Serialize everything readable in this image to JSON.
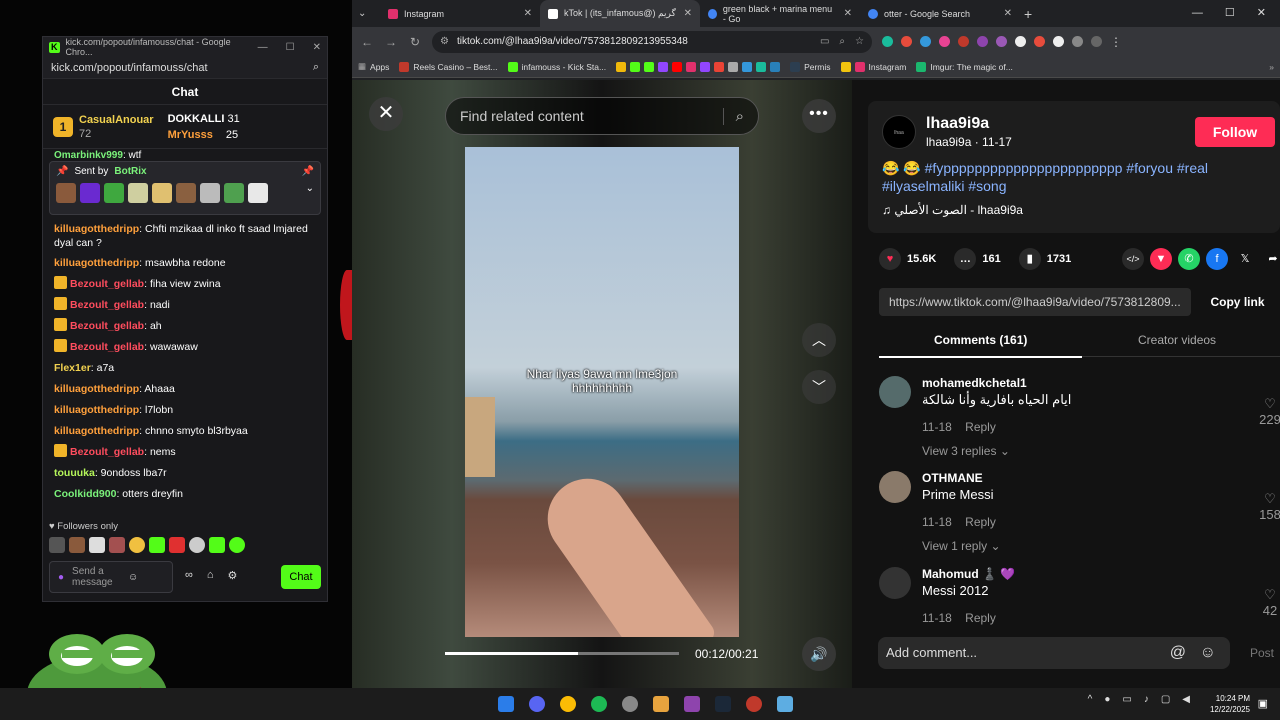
{
  "kick": {
    "window_title": "kick.com/popout/infamouss/chat - Google Chro...",
    "url": "kick.com/popout/infamouss/chat",
    "chat_title": "Chat",
    "leaders": [
      {
        "rank": "1",
        "name": "CasualAnouar",
        "count": "72"
      },
      {
        "name": "DOKKALLI",
        "count": "31"
      },
      {
        "name": "MrYusss",
        "count": "25"
      }
    ],
    "cut_message": {
      "user": "Omarbinkv999",
      "text": ": wtf"
    },
    "pinned": {
      "label": "Sent by",
      "user": "BotRix"
    },
    "messages": [
      {
        "user": "killuagotthedripp",
        "cls": "u-orange",
        "text": ": Chfti mzikaa dl inko ft saad lmjared dyal can ?",
        "crown": false
      },
      {
        "user": "killuagotthedripp",
        "cls": "u-orange",
        "text": ": msawbha redone",
        "crown": false
      },
      {
        "user": "Bezoult_gellab",
        "cls": "u-red",
        "text": ": fiha view zwina",
        "crown": true
      },
      {
        "user": "Bezoult_gellab",
        "cls": "u-red",
        "text": ": nadi",
        "crown": true
      },
      {
        "user": "Bezoult_gellab",
        "cls": "u-red",
        "text": ": ah",
        "crown": true
      },
      {
        "user": "Bezoult_gellab",
        "cls": "u-red",
        "text": ": wawawaw",
        "crown": true
      },
      {
        "user": "Flex1er",
        "cls": "u-yellow",
        "text": ": a7a",
        "crown": false
      },
      {
        "user": "killuagotthedripp",
        "cls": "u-orange",
        "text": ": Ahaaa",
        "crown": false
      },
      {
        "user": "killuagotthedripp",
        "cls": "u-orange",
        "text": ": l7lobn",
        "crown": false
      },
      {
        "user": "killuagotthedripp",
        "cls": "u-orange",
        "text": ": chnno smyto bl3rbyaa",
        "crown": false
      },
      {
        "user": "Bezoult_gellab",
        "cls": "u-red",
        "text": ": nems",
        "crown": true
      },
      {
        "user": "touuuka",
        "cls": "u-lime",
        "text": ": 9ondoss lba7r",
        "crown": false
      },
      {
        "user": "Coolkidd900",
        "cls": "u-green",
        "text": ": otters dreyfin",
        "crown": false
      }
    ],
    "followers_only": "Followers only",
    "input_placeholder": "Send a message",
    "send_label": "Chat"
  },
  "chrome": {
    "tabs": [
      {
        "title": "Instagram",
        "active": false,
        "color": "#e1306c"
      },
      {
        "title": "kTok | (its_infamous@) گريم",
        "active": true,
        "color": "#ffffff"
      },
      {
        "title": "green black + marina menu - Go",
        "active": false,
        "color": "#4285f4"
      },
      {
        "title": "otter - Google Search",
        "active": false,
        "color": "#4285f4"
      }
    ],
    "url": "tiktok.com/@lhaa9i9a/video/7573812809213955348",
    "bookmarks": [
      "Apps",
      "Reels Casino – Best...",
      "infamouss - Kick Sta...",
      "Permis",
      "Instagram",
      "Imgur: The magic of..."
    ]
  },
  "tiktok": {
    "search_placeholder": "Find related content",
    "caption": "Nhar ilyas 9awa mn lme3jon hhhhhhhhh",
    "time": "00:12/00:21",
    "progress": 0.57,
    "avatar_text": "lhaa",
    "username": "lhaa9i9a",
    "subline": "lhaa9i9a · 11-17",
    "follow": "Follow",
    "description": "😂 😂 #fyppppppppppppppppppppppp #foryou #real #ilyaselmaliki #song",
    "sound": "♫  الصوت الأصلي - lhaa9i9a",
    "likes": "15.6K",
    "comments_count": "161",
    "saves": "1731",
    "link": "https://www.tiktok.com/@lhaa9i9a/video/7573812809...",
    "copy_link": "Copy link",
    "tab_comments": "Comments (161)",
    "tab_creator": "Creator videos",
    "comments": [
      {
        "name": "mohamedkchetal1",
        "text": "ايام الحياه بافارية وأنا شالكة",
        "date": "11-18",
        "reply": "Reply",
        "likes": "229",
        "replies": "View 3 replies ⌄"
      },
      {
        "name": "OTHMANE",
        "text": "Prime Messi",
        "date": "11-18",
        "reply": "Reply",
        "likes": "158",
        "replies": "View 1 reply ⌄"
      },
      {
        "name": "Mahomud ♟️ 💜",
        "text": "Messi 2012",
        "date": "11-18",
        "reply": "Reply",
        "likes": "42",
        "replies": ""
      }
    ],
    "add_comment": "Add comment...",
    "post": "Post"
  },
  "taskbar": {
    "time": "10:24 PM",
    "date": "12/22/2025"
  }
}
